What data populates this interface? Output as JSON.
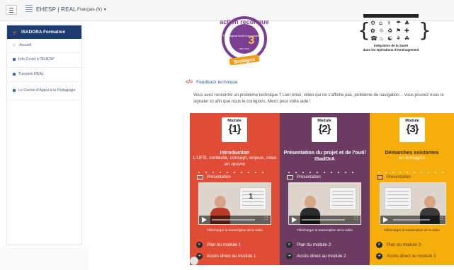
{
  "header": {
    "brand": "EHESP | REAL",
    "language": "Français (fr)"
  },
  "sidebar": {
    "title": "ISADORA Formation",
    "items": [
      {
        "label": "Accueil"
      },
      {
        "label": "Info Covid à l'EHESP"
      },
      {
        "label": "Tutoriels REAL"
      },
      {
        "label": "Le Centre d'Appui à la Pédagogie"
      }
    ]
  },
  "logos": {
    "seal_lines": [
      "action reconnue",
      "Plan Régional Santé Environnement",
      "Bretagne",
      "3",
      "2017-2021"
    ],
    "isadora_caption": [
      "Intégration de la Santé",
      "dans les Opérations d'Aménagement"
    ]
  },
  "feedback": {
    "link": "Feedback technique",
    "notice": "Vous avez rencontré un problème technique ? Lien brisé, vidéo qui ne s'affiche pas, problème de navigation... Vous pouvez nous le signaler ici afin que nous le corrigions. Merci pour votre aide !"
  },
  "modules": [
    {
      "module_word": "Module",
      "number": "1",
      "title": "Introduction",
      "subtitle": "L'UFS, contexte, concept, enjeux, mise en œuvre",
      "presentation": "Présentation",
      "download": "Télécharger la transcription de la vidéo",
      "plan": "Plan du module 1",
      "access": "Accès direct au module 1",
      "slide_num": "1",
      "color": "#e14c37"
    },
    {
      "module_word": "Module",
      "number": "2",
      "title": "Présentation du projet et de l'outil ISadOrA",
      "subtitle": "",
      "presentation": "Présentation",
      "download": "Télécharger la transcription de la vidéo",
      "plan": "Plan du module 2",
      "access": "Accès direct au module 2",
      "slide_num": "",
      "color": "#6c3b62"
    },
    {
      "module_word": "Module",
      "number": "3",
      "title": "Démarches existantes",
      "subtitle": "en Bretagne",
      "presentation": "Présentation",
      "download": "Télécharger la transcription de la vidéo",
      "plan": "Plan du module 3",
      "access": "Accès direct au module 3",
      "slide_num": "",
      "color": "#f6ae0c"
    }
  ]
}
